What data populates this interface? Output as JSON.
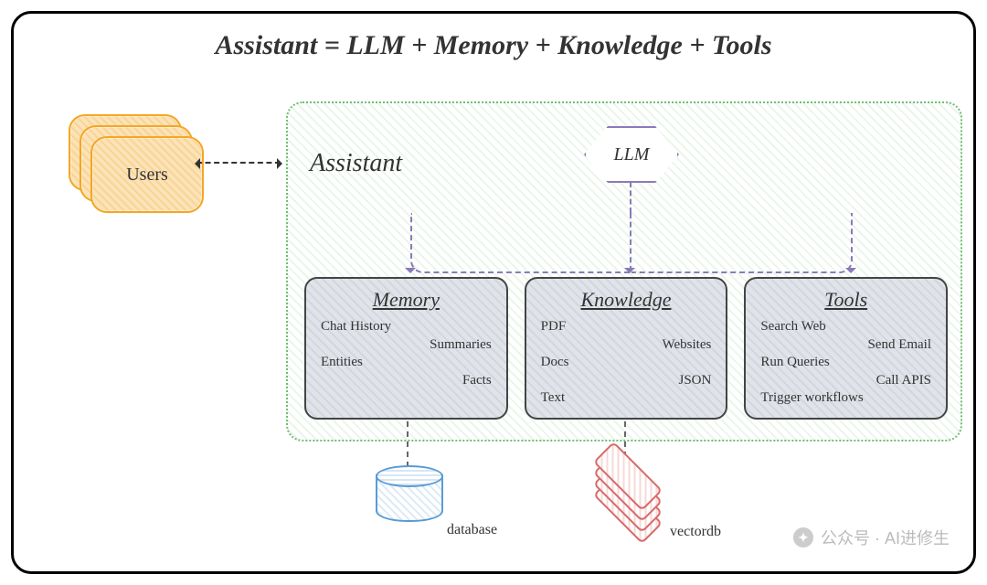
{
  "title": "Assistant = LLM + Memory + Knowledge + Tools",
  "users_label": "Users",
  "assistant_label": "Assistant",
  "llm_label": "LLM",
  "components": {
    "memory": {
      "heading": "Memory",
      "items": [
        "Chat History",
        "Summaries",
        "Entities",
        "Facts"
      ]
    },
    "knowledge": {
      "heading": "Knowledge",
      "items": [
        "PDF",
        "Websites",
        "Docs",
        "JSON",
        "Text"
      ]
    },
    "tools": {
      "heading": "Tools",
      "items": [
        "Search Web",
        "Send Email",
        "Run Queries",
        "Call APIS",
        "Trigger workflows"
      ]
    }
  },
  "storage": {
    "database_label": "database",
    "vectordb_label": "vectordb"
  },
  "watermark": "公众号 · AI进修生"
}
